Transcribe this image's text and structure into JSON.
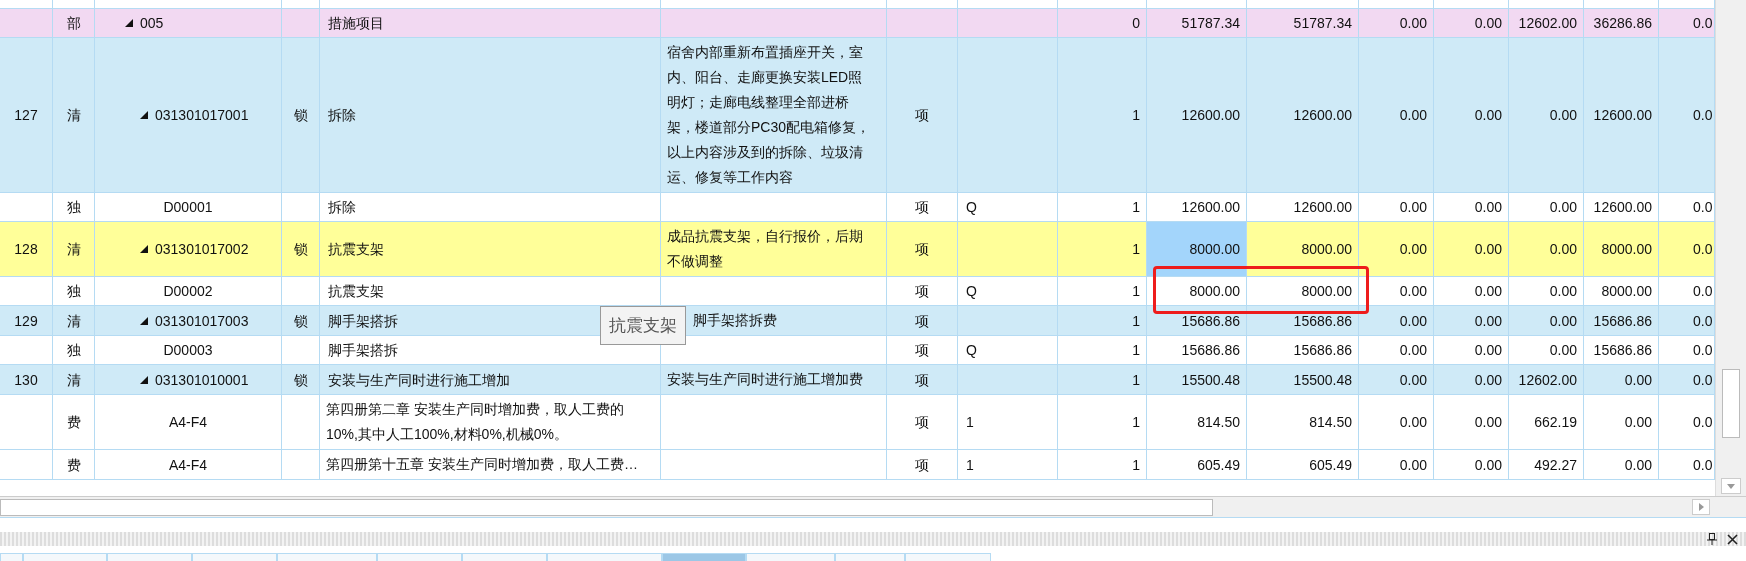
{
  "table": {
    "rows": [
      {
        "kind": "division",
        "expanded": true,
        "selected": false,
        "cells": [
          "",
          "部",
          "005",
          "",
          "措施项目",
          "",
          "",
          "",
          "0",
          "51787.34",
          "51787.34",
          "0.00",
          "0.00",
          "12602.00",
          "36286.86",
          "0.0"
        ]
      },
      {
        "kind": "bill",
        "expanded": true,
        "selected": false,
        "cells": [
          "127",
          "清",
          "031301017001",
          "锁",
          "拆除",
          "宿舍内部重新布置插座开关，室内、阳台、走廊更换安装LED照明灯；走廊电线整理全部进桥架，楼道部分PC30配电箱修复，以上内容涉及到的拆除、垃圾清运、修复等工作内容",
          "项",
          "",
          "1",
          "12600.00",
          "12600.00",
          "0.00",
          "0.00",
          "0.00",
          "12600.00",
          "0.0"
        ]
      },
      {
        "kind": "entry",
        "selected": false,
        "cells": [
          "",
          "独",
          "D00001",
          "",
          "拆除",
          "",
          "项",
          "Q",
          "1",
          "12600.00",
          "12600.00",
          "0.00",
          "0.00",
          "0.00",
          "12600.00",
          "0.0"
        ]
      },
      {
        "kind": "bill_flagged",
        "expanded": true,
        "selected": true,
        "cells": [
          "128",
          "清",
          "031301017002",
          "锁",
          "抗震支架",
          "成品抗震支架，自行报价，后期不做调整",
          "项",
          "",
          "1",
          "8000.00",
          "8000.00",
          "0.00",
          "0.00",
          "0.00",
          "8000.00",
          "0.0"
        ]
      },
      {
        "kind": "entry",
        "selected": false,
        "cells": [
          "",
          "独",
          "D00002",
          "",
          "抗震支架",
          "",
          "项",
          "Q",
          "1",
          "8000.00",
          "8000.00",
          "0.00",
          "0.00",
          "0.00",
          "8000.00",
          "0.0"
        ]
      },
      {
        "kind": "bill",
        "expanded": true,
        "selected": false,
        "cells": [
          "129",
          "清",
          "031301017003",
          "锁",
          "脚手架搭拆",
          "脚手架搭拆费",
          "项",
          "",
          "1",
          "15686.86",
          "15686.86",
          "0.00",
          "0.00",
          "0.00",
          "15686.86",
          "0.0"
        ]
      },
      {
        "kind": "entry",
        "selected": false,
        "cells": [
          "",
          "独",
          "D00003",
          "",
          "脚手架搭拆",
          "",
          "项",
          "Q",
          "1",
          "15686.86",
          "15686.86",
          "0.00",
          "0.00",
          "0.00",
          "15686.86",
          "0.0"
        ]
      },
      {
        "kind": "bill",
        "expanded": true,
        "selected": false,
        "cells": [
          "130",
          "清",
          "031301010001",
          "锁",
          "安装与生产同时进行施工增加",
          "安装与生产同时进行施工增加费",
          "项",
          "",
          "1",
          "15500.48",
          "15500.48",
          "0.00",
          "0.00",
          "12602.00",
          "0.00",
          "0.0"
        ]
      },
      {
        "kind": "entry",
        "selected": false,
        "cells": [
          "",
          "费",
          "A4-F4",
          "",
          "第四册第二章 安装生产同时增加费，取人工费的10%,其中人工100%,材料0%,机械0%。",
          "",
          "项",
          "1",
          "1",
          "814.50",
          "814.50",
          "0.00",
          "0.00",
          "662.19",
          "0.00",
          "0.0"
        ]
      },
      {
        "kind": "entry",
        "selected": false,
        "cells": [
          "",
          "费",
          "A4-F4",
          "",
          "第四册第十五章 安装生产同时增加费，取人工费…",
          "",
          "项",
          "1",
          "1",
          "605.49",
          "605.49",
          "0.00",
          "0.00",
          "492.27",
          "0.00",
          "0.0"
        ]
      }
    ]
  },
  "tooltip": {
    "text": "抗震支架"
  },
  "bottom_tabs": [
    {
      "selected": false
    },
    {
      "selected": false
    },
    {
      "selected": false
    },
    {
      "selected": false
    },
    {
      "selected": false
    },
    {
      "selected": false
    },
    {
      "selected": false
    },
    {
      "selected": false
    },
    {
      "selected": true
    },
    {
      "selected": false
    },
    {
      "selected": false
    },
    {
      "selected": false
    }
  ]
}
